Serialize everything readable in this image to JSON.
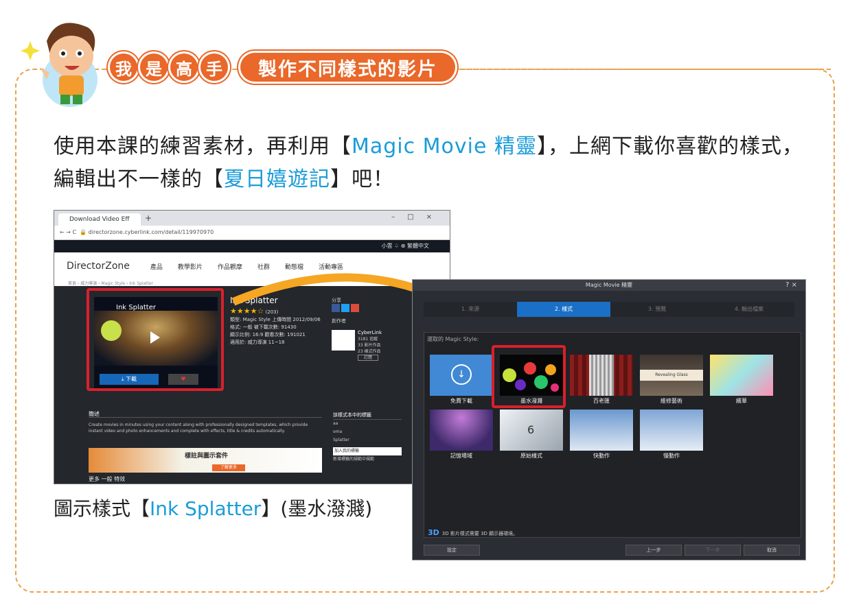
{
  "header": {
    "badge_chars": [
      "我",
      "是",
      "高",
      "手"
    ],
    "title": "製作不同樣式的影片"
  },
  "instruction": {
    "part1": "使用本課的練習素材，再利用【",
    "highlight1": "Magic Movie 精靈",
    "part2": "】，上網下載你喜歡的樣式，編輯出不一樣的【",
    "highlight2": "夏日嬉遊記",
    "part3": "】吧！"
  },
  "caption": {
    "prefix": "圖示樣式【",
    "highlight": "Ink Splatter",
    "suffix": "】(墨水潑濺)"
  },
  "browser": {
    "tab_title": "Download Video Eff",
    "address": "directorzone.cyberlink.com/detail/119970970",
    "topbar": "小雲 ♤   ⊕ 繁體中文",
    "logo": "DirectorZone",
    "nav": [
      "產品",
      "教學影片",
      "作品觀摩",
      "社群",
      "動態檔",
      "活動專區"
    ],
    "breadcrumb": "首頁 › 威力導演 › Magic Style › Ink Splatter",
    "video_title": "Ink Splatter",
    "download_label": "⤓  下載",
    "fav_label": "♥",
    "item_title": "Ink Splatter",
    "stars": "★★★★☆",
    "rating_count": "(203)",
    "meta": [
      "類型: Magic Style    上傳時間 2012/09/06",
      "格式: 一般          被下載次數: 91430",
      "顯示比例: 16:9       觀看次數: 191021",
      "適用於: 威力導演 11~18"
    ],
    "share_label": "分享",
    "author_label": "創作者",
    "author": "CyberLink",
    "author_stats": [
      "3181 追蹤",
      "33 影片作品",
      "23 樣式作品"
    ],
    "subscribe": "訂閱",
    "desc_heading": "簡述",
    "desc_text": "Create movies in minutes using your content along with professionally designed templates, which provide instant video and photo enhancements and complete with effects, title & credits automatically.",
    "banner_text": "樣註與圖示套件",
    "banner_button": "了解更多",
    "more": "更多 一般 特效",
    "side_heading": "該樣式本中的標籤",
    "side_tags": [
      "aa",
      "oma",
      "Splatter"
    ],
    "side_input": "加入我的標籤",
    "side_note": "新增標籤的規範中規範"
  },
  "dialog": {
    "title": "Magic Movie 精靈",
    "controls": "?  ×",
    "steps": [
      "1. 來源",
      "2. 樣式",
      "3. 預覽",
      "4. 輸出檔案"
    ],
    "grid_label": "選取的 Magic Style:",
    "styles": [
      {
        "label": "免費下載"
      },
      {
        "label": "墨水潑濺"
      },
      {
        "label": "百老匯"
      },
      {
        "label": "維修藝術"
      },
      {
        "label": "繽華"
      },
      {
        "label": "記憶場域"
      },
      {
        "label": "原始樣式"
      },
      {
        "label": "快動作"
      },
      {
        "label": "慢動作"
      }
    ],
    "note_3d": "3D",
    "note_text": "3D 影片樣式需要 3D 顯示器環境。",
    "btn_settings": "設定",
    "btn_prev": "上一步",
    "btn_next": "下一步",
    "btn_cancel": "取消"
  },
  "colors": {
    "accent_orange": "#e9682a",
    "highlight_blue": "#1a9cd8",
    "red_frame": "#d9202c"
  }
}
